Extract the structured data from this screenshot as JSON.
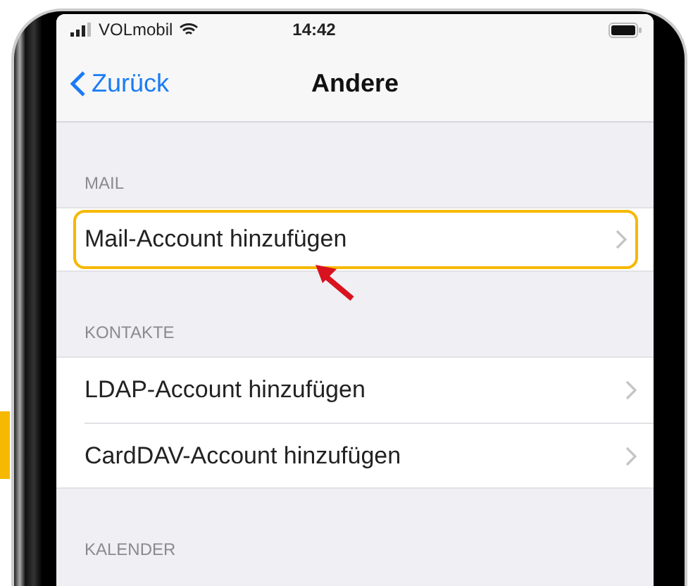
{
  "status_bar": {
    "carrier": "VOLmobil",
    "time": "14:42"
  },
  "nav_bar": {
    "back_label": "Zurück",
    "title": "Andere"
  },
  "sections": [
    {
      "title": "MAIL",
      "items": [
        {
          "label": "Mail-Account hinzufügen",
          "highlighted": true
        }
      ]
    },
    {
      "title": "KONTAKTE",
      "items": [
        {
          "label": "LDAP-Account hinzufügen",
          "highlighted": false
        },
        {
          "label": "CardDAV-Account hinzufügen",
          "highlighted": false
        }
      ]
    },
    {
      "title": "KALENDER"
    }
  ]
}
